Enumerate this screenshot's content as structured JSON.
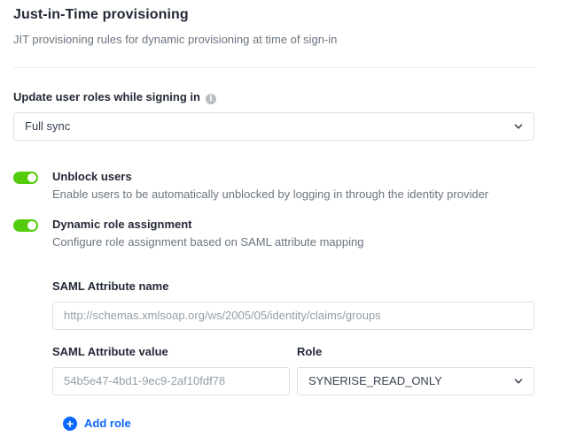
{
  "section": {
    "title": "Just-in-Time provisioning",
    "subtitle": "JIT provisioning rules for dynamic provisioning at time of sign-in"
  },
  "update_roles": {
    "label": "Update user roles while signing in",
    "info_icon": "info-icon",
    "selected": "Full sync"
  },
  "toggles": [
    {
      "title": "Unblock users",
      "description": "Enable users to be automatically unblocked by logging in through the identity provider",
      "on": true
    },
    {
      "title": "Dynamic role assignment",
      "description": "Configure role assignment based on SAML attribute mapping",
      "on": true
    }
  ],
  "saml": {
    "attr_name_label": "SAML Attribute name",
    "attr_name_placeholder": "http://schemas.xmlsoap.org/ws/2005/05/identity/claims/groups",
    "attr_value_label": "SAML Attribute value",
    "attr_value_placeholder": "54b5e47-4bd1-9ec9-2af10fdf78",
    "role_label": "Role",
    "role_selected": "SYNERISE_READ_ONLY"
  },
  "add_role": {
    "label": "Add role",
    "icon": "plus-icon"
  },
  "colors": {
    "toggle_on": "#54cb0b",
    "accent": "#0b68ff"
  }
}
